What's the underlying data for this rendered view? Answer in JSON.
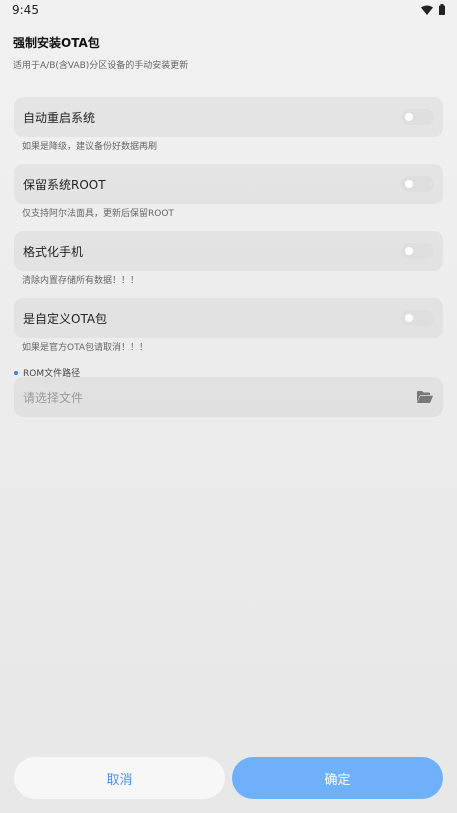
{
  "status_bar": {
    "time": "9:45",
    "icons": [
      "wifi-icon",
      "battery-icon"
    ]
  },
  "header": {
    "title": "强制安装OTA包",
    "subtitle": "适用于A/B(含VAB)分区设备的手动安装更新"
  },
  "options": [
    {
      "label": "自动重启系统",
      "hint": "如果是降级，建议备份好数据再刷",
      "enabled": false
    },
    {
      "label": "保留系统ROOT",
      "hint": "仅支持阿尔法面具，更新后保留ROOT",
      "enabled": false
    },
    {
      "label": "格式化手机",
      "hint": "清除内置存储所有数据！！！",
      "enabled": false
    },
    {
      "label": "是自定义OTA包",
      "hint": "如果是官方OTA包请取消！！！",
      "enabled": false
    }
  ],
  "rom_path": {
    "label": "ROM文件路径",
    "placeholder": "请选择文件",
    "value": "",
    "icon": "folder-open-icon"
  },
  "actions": {
    "cancel_label": "取消",
    "confirm_label": "确定"
  },
  "colors": {
    "accent": "#6eb1fa",
    "cancel_text": "#4b8ff0",
    "dot": "#3b82f6"
  }
}
